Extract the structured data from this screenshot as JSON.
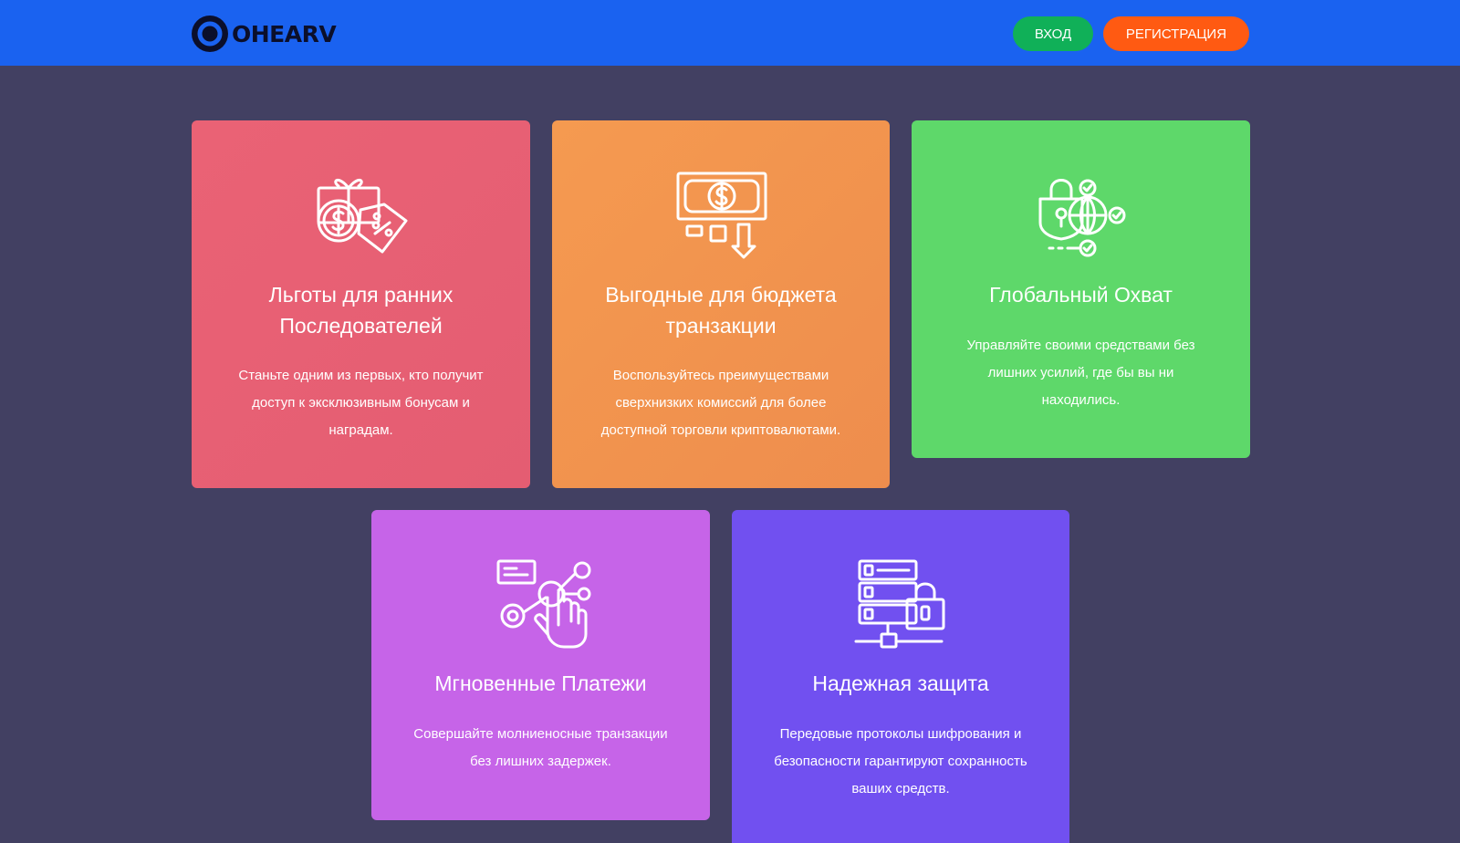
{
  "header": {
    "logo_text": "OHEARV",
    "login_label": "ВХОД",
    "register_label": "РЕГИСТРАЦИЯ",
    "colors": {
      "bar": "#1a62f0",
      "login": "#10b058",
      "register": "#ff5a12"
    }
  },
  "features": [
    {
      "icon": "gift-coin-discount-icon",
      "title_line1": "Льготы для ранних",
      "title_line2": "Последователей",
      "text_line1": "Станьте одним из первых, кто получит",
      "text_line2": "доступ к эксклюзивным бонусам и",
      "text_line3": "наградам.",
      "color": "#e85f74"
    },
    {
      "icon": "banknote-arrow-down-icon",
      "title_line1": "Выгодные для бюджета",
      "title_line2": "транзакции",
      "text_line1": "Воспользуйтесь преимуществами",
      "text_line2": "сверхнизких комиссий для более",
      "text_line3": "доступной торговли криптовалютами.",
      "color": "#f2944f"
    },
    {
      "icon": "lock-globe-network-icon",
      "title": "Глобальный Охват",
      "text_line1": "Управляйте своими средствами без",
      "text_line2": "лишних усилий, где бы вы ни",
      "text_line3": "находились.",
      "color": "#5ed86a"
    },
    {
      "icon": "hand-tap-network-icon",
      "title": "Мгновенные Платежи",
      "text_line1": "Совершайте молниеносные транзакции",
      "text_line2": "без лишних задержек.",
      "color": "#c664e8"
    },
    {
      "icon": "server-lock-icon",
      "title": "Надежная защита",
      "text_line1": "Передовые протоколы шифрования и",
      "text_line2": "безопасности гарантируют сохранность",
      "text_line3": "ваших средств.",
      "color": "#7150f0"
    }
  ]
}
